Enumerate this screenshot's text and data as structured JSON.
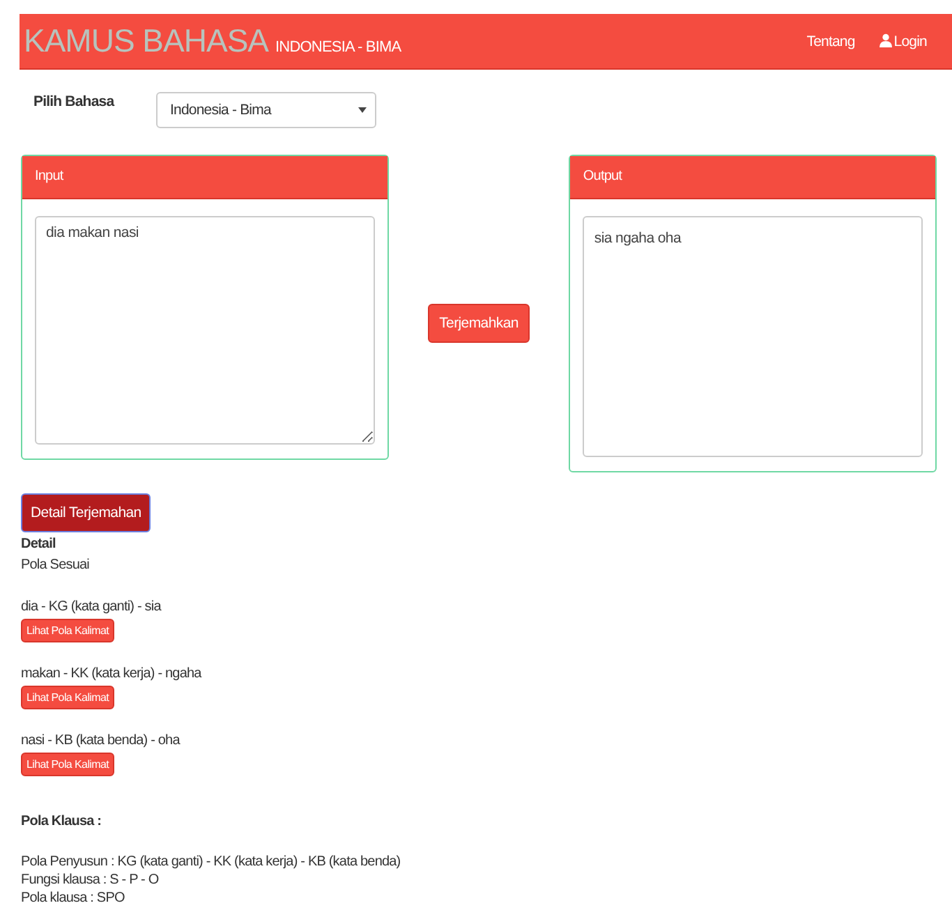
{
  "navbar": {
    "brand": "KAMUS BAHASA",
    "subtitle": "INDONESIA - BIMA",
    "links": [
      {
        "label": "Tentang",
        "kind": "text"
      },
      {
        "label": "Login",
        "kind": "user"
      }
    ]
  },
  "language": {
    "label": "Pilih Bahasa",
    "value": "Indonesia - Bima"
  },
  "input_panel": {
    "title": "Input",
    "value": "dia makan nasi"
  },
  "translate_button": "Terjemahkan",
  "output_panel": {
    "title": "Output",
    "value": "sia ngaha oha"
  },
  "detail_button": "Detail Terjemahan",
  "detail": {
    "heading": "Detail",
    "status": "Pola Sesuai",
    "words": [
      {
        "text": "dia - KG (kata ganti) - sia",
        "button": "Lihat Pola Kalimat"
      },
      {
        "text": "makan - KK (kata kerja) - ngaha",
        "button": "Lihat Pola Kalimat"
      },
      {
        "text": "nasi - KB (kata benda) - oha",
        "button": "Lihat Pola Kalimat"
      }
    ]
  },
  "clause": {
    "heading": "Pola Klausa :",
    "lines": [
      "Pola Penyusun : KG (kata ganti) - KK (kata kerja) - KB (kata benda)",
      "Fungsi klausa : S - P - O",
      "Pola klausa : SPO"
    ]
  }
}
